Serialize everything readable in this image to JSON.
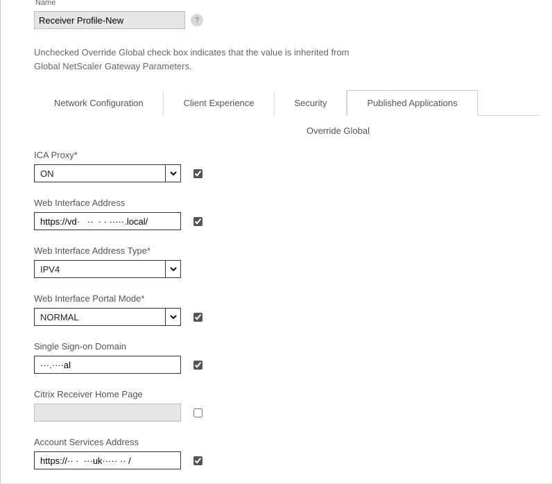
{
  "nameLabel": "Name",
  "profileName": "Receiver Profile-New",
  "note1": "Unchecked Override Global check box indicates that the value is inherited from",
  "note2": "Global NetScaler Gateway Parameters.",
  "tabs": {
    "network": "Network Configuration",
    "client": "Client Experience",
    "security": "Security",
    "published": "Published Applications"
  },
  "overrideHeader": "Override Global",
  "fields": {
    "icaProxy": {
      "label": "ICA Proxy*",
      "value": "ON",
      "checked": true
    },
    "webAddr": {
      "label": "Web Interface Address",
      "value": "https://vd·   ··  · · ·····.local/",
      "checked": true
    },
    "webAddrType": {
      "label": "Web Interface Address Type*",
      "value": "IPV4",
      "checked": false
    },
    "portalMode": {
      "label": "Web Interface Portal Mode*",
      "value": "NORMAL",
      "checked": true
    },
    "sso": {
      "label": "Single Sign-on Domain",
      "value": "···.····al",
      "checked": true
    },
    "homePage": {
      "label": "Citrix Receiver Home Page",
      "value": "",
      "checked": false
    },
    "acctSvc": {
      "label": "Account Services Address",
      "value": "https://·· ·  ···uk····· ·· /",
      "checked": true
    }
  }
}
